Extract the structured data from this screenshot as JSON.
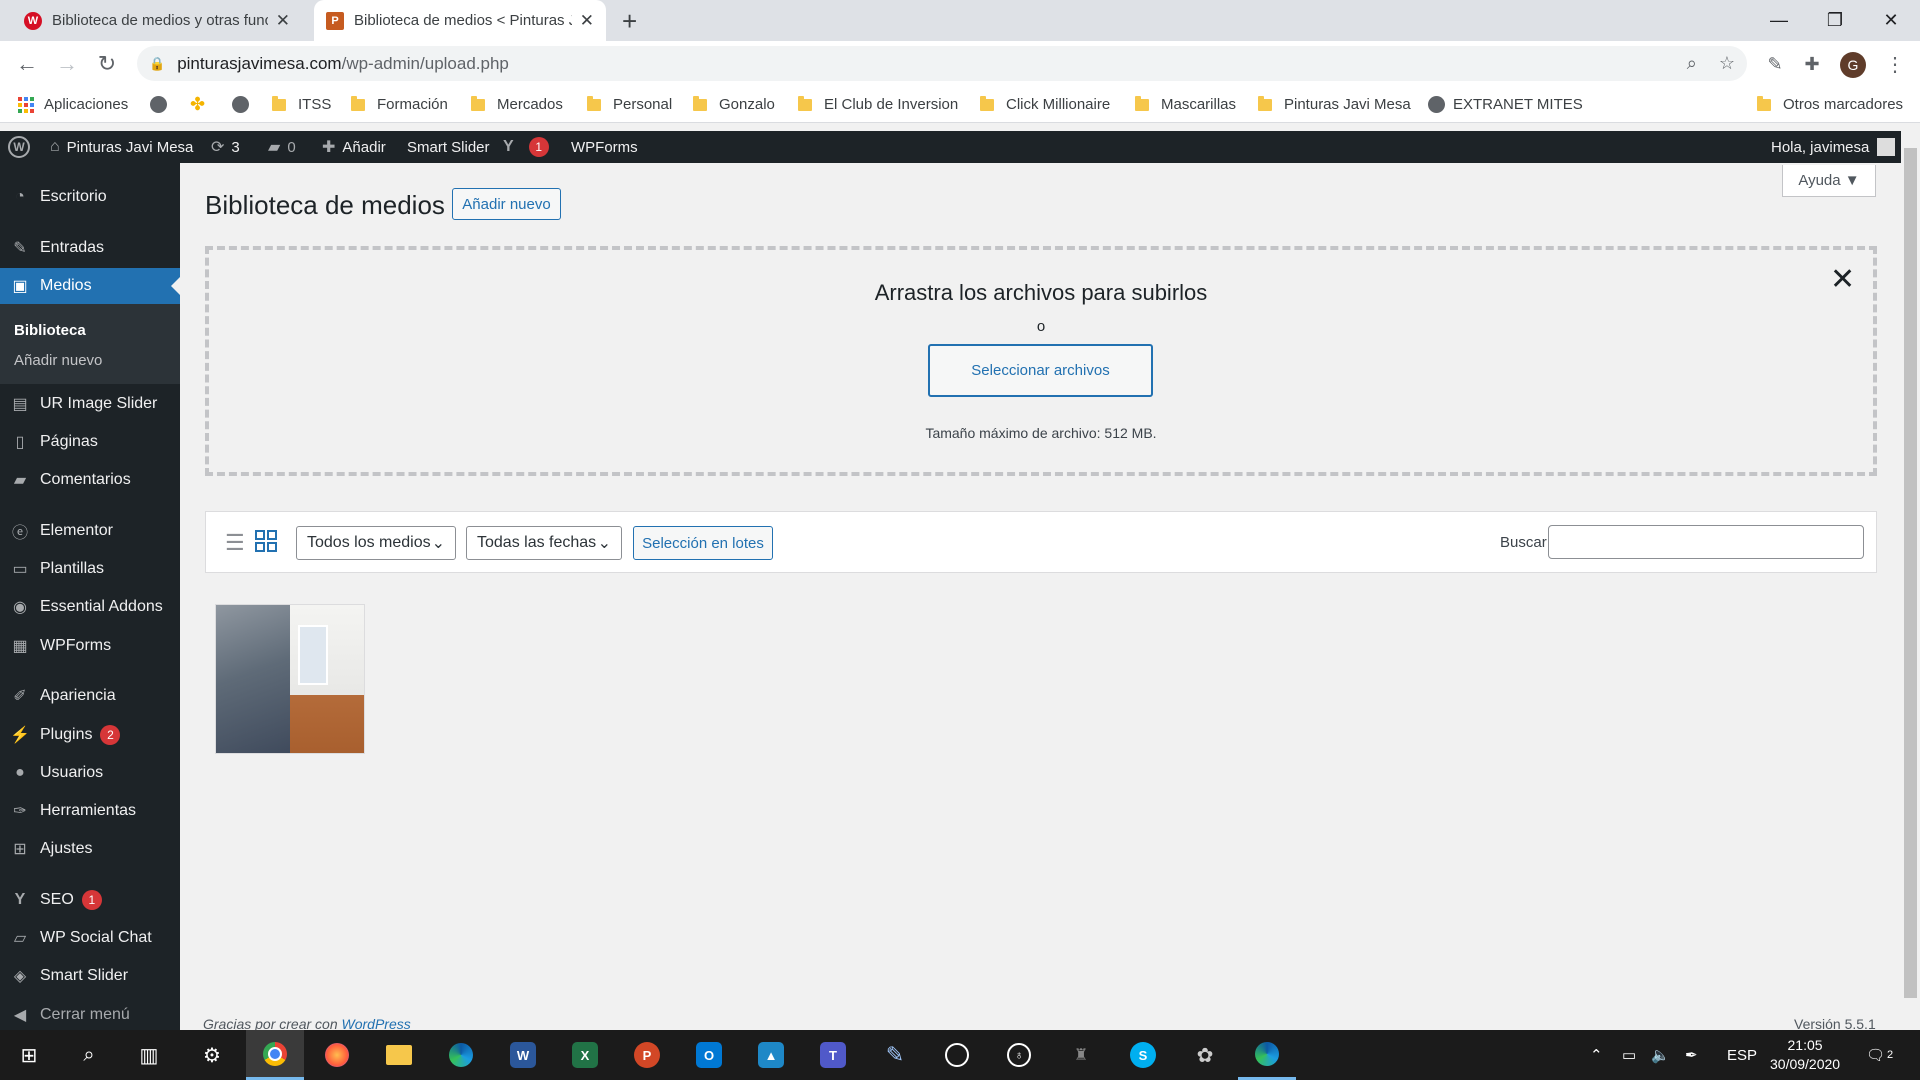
{
  "browser": {
    "tabs": [
      {
        "title": "Biblioteca de medios y otras func",
        "active": false
      },
      {
        "title": "Biblioteca de medios < Pinturas J",
        "active": true
      }
    ],
    "new_tab": "+",
    "url_host": "pinturasjavimesa.com",
    "url_path": "/wp-admin/upload.php",
    "profile_initial": "G",
    "window_controls": {
      "minimize": "—",
      "maximize": "❐",
      "close": "✕"
    }
  },
  "bookmarks": [
    "Aplicaciones",
    "ITSS",
    "Formación",
    "Mercados",
    "Personal",
    "Gonzalo",
    "El Club de Inversion",
    "Click Millionaire",
    "Mascarillas",
    "Pinturas Javi Mesa",
    "EXTRANET MITES",
    "Otros marcadores"
  ],
  "adminbar": {
    "site_name": "Pinturas Javi Mesa",
    "updates_count": "3",
    "comments_count": "0",
    "add_new": "Añadir",
    "smart_slider": "Smart Slider",
    "yoast_badge": "1",
    "wpforms": "WPForms",
    "greeting": "Hola, javimesa"
  },
  "sidebar": {
    "items": [
      {
        "label": "Escritorio",
        "icon": "dashboard-icon"
      },
      {
        "label": "Entradas",
        "icon": "pin-icon"
      },
      {
        "label": "Medios",
        "icon": "media-icon"
      },
      {
        "label": "UR Image Slider",
        "icon": "slides-icon"
      },
      {
        "label": "Páginas",
        "icon": "page-icon"
      },
      {
        "label": "Comentarios",
        "icon": "comment-icon"
      },
      {
        "label": "Elementor",
        "icon": "elementor-icon"
      },
      {
        "label": "Plantillas",
        "icon": "folder-icon"
      },
      {
        "label": "Essential Addons",
        "icon": "ea-icon"
      },
      {
        "label": "WPForms",
        "icon": "forms-icon"
      },
      {
        "label": "Apariencia",
        "icon": "brush-icon"
      },
      {
        "label": "Plugins",
        "icon": "plug-icon",
        "badge": "2"
      },
      {
        "label": "Usuarios",
        "icon": "user-icon"
      },
      {
        "label": "Herramientas",
        "icon": "wrench-icon"
      },
      {
        "label": "Ajustes",
        "icon": "settings-icon"
      },
      {
        "label": "SEO",
        "icon": "yoast-icon",
        "badge": "1"
      },
      {
        "label": "WP Social Chat",
        "icon": "chat-icon"
      },
      {
        "label": "Smart Slider",
        "icon": "slider-icon"
      },
      {
        "label": "Cerrar menú",
        "icon": "collapse-icon"
      }
    ],
    "submenu": [
      "Biblioteca",
      "Añadir nuevo"
    ]
  },
  "page": {
    "title": "Biblioteca de medios",
    "add_new_button": "Añadir nuevo",
    "help_button": "Ayuda ▼",
    "dropzone": {
      "heading": "Arrastra los archivos para subirlos",
      "or": "o",
      "select_button": "Seleccionar archivos",
      "max_size": "Tamaño máximo de archivo: 512 MB."
    },
    "filters": {
      "media_type": "Todos los medios",
      "dates": "Todas las fechas",
      "bulk_select": "Selección en lotes",
      "search_label": "Buscar",
      "search_value": ""
    },
    "footer_text": "Gracias por crear con ",
    "footer_link": "WordPress",
    "version": "Versión 5.5.1"
  },
  "taskbar": {
    "language": "ESP",
    "time": "21:05",
    "date": "30/09/2020",
    "notification_count": "2"
  },
  "colors": {
    "wp_admin_dark": "#1d2327",
    "wp_blue": "#2271b1",
    "badge_red": "#d63638"
  }
}
